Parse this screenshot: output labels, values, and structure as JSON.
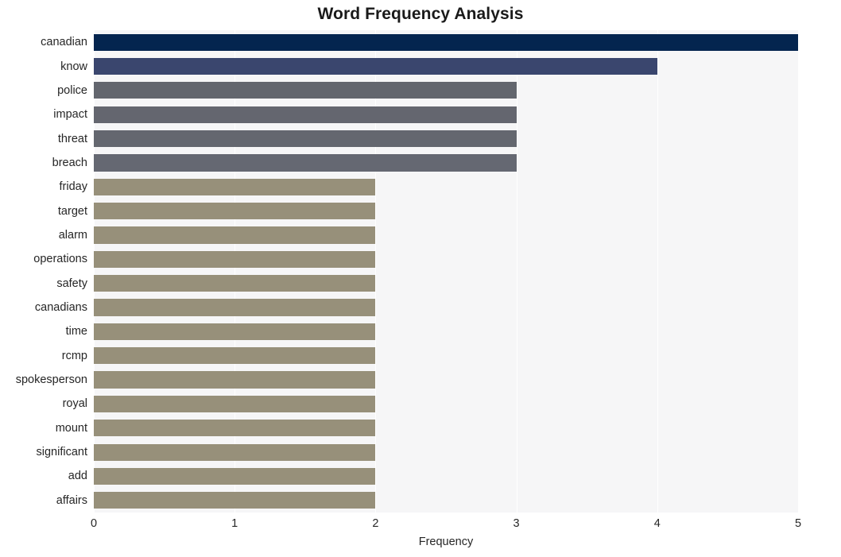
{
  "chart_data": {
    "type": "bar",
    "orientation": "horizontal",
    "title": "Word Frequency Analysis",
    "xlabel": "Frequency",
    "ylabel": "",
    "xlim": [
      0,
      5
    ],
    "xticks": [
      "0",
      "1",
      "2",
      "3",
      "4",
      "5"
    ],
    "grid": true,
    "legend": null,
    "categories": [
      "canadian",
      "know",
      "police",
      "impact",
      "threat",
      "breach",
      "friday",
      "target",
      "alarm",
      "operations",
      "safety",
      "canadians",
      "time",
      "rcmp",
      "spokesperson",
      "royal",
      "mount",
      "significant",
      "add",
      "affairs"
    ],
    "values": [
      5,
      4,
      3,
      3,
      3,
      3,
      2,
      2,
      2,
      2,
      2,
      2,
      2,
      2,
      2,
      2,
      2,
      2,
      2,
      2
    ],
    "bar_colors": [
      "#04254f",
      "#3a466e",
      "#63666e",
      "#64666f",
      "#64676f",
      "#656872",
      "#97907a",
      "#97907a",
      "#97907a",
      "#97907a",
      "#97907a",
      "#97907a",
      "#97907a",
      "#97907a",
      "#97907a",
      "#97907a",
      "#97907a",
      "#97907a",
      "#97907a",
      "#97907a"
    ]
  },
  "style": {
    "plot_background": "#f6f6f7",
    "figure_background": "#ffffff",
    "gridline_color": "#ffffff",
    "text_color": "#262626",
    "title_color": "#1a1a1a"
  }
}
